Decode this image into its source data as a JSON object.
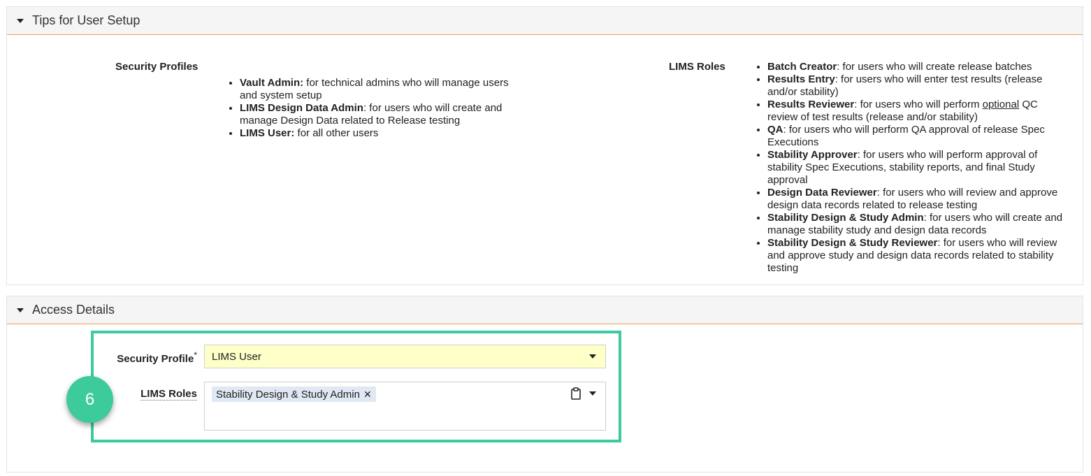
{
  "tips_panel": {
    "title": "Tips for User Setup",
    "security_profiles": {
      "label": "Security Profiles",
      "items": [
        {
          "name": "Vault Admin:",
          "desc": " for technical admins who will manage users and system setup"
        },
        {
          "name": "LIMS Design Data Admin",
          "desc": ": for users who will create and manage Design Data related to Release testing"
        },
        {
          "name": "LIMS User:",
          "desc": " for all other users"
        }
      ]
    },
    "lims_roles": {
      "label": "LIMS Roles",
      "items": [
        {
          "name": "Batch Creator",
          "desc": ": for users who will create release batches"
        },
        {
          "name": "Results Entry",
          "desc": ": for users who will enter test results (release and/or stability)"
        },
        {
          "name": "Results Reviewer",
          "desc_before": ": for users who will perform ",
          "desc_underline": "optional",
          "desc_after": " QC review of test results (release and/or stability)"
        },
        {
          "name": "QA",
          "desc": ": for users who will perform QA approval of release Spec Executions"
        },
        {
          "name": "Stability Approver",
          "desc": ": for users who will perform approval of stability Spec Executions, stability reports, and final Study approval"
        },
        {
          "name": "Design Data Reviewer",
          "desc": ": for users who will review and approve design data records related to release testing"
        },
        {
          "name": "Stability Design & Study Admin",
          "desc": ": for users who will create and manage stability study and design data records"
        },
        {
          "name": "Stability Design & Study Reviewer",
          "desc": ": for users who will review and approve study and design data records related to stability testing"
        }
      ]
    }
  },
  "access_panel": {
    "title": "Access Details",
    "security_profile": {
      "label": "Security Profile",
      "required_marker": "*",
      "value": "LIMS User"
    },
    "lims_roles": {
      "label": "LIMS Roles",
      "chips": [
        {
          "label": "Stability Design & Study Admin",
          "remove": "✕"
        }
      ]
    },
    "step_badge": "6"
  },
  "colors": {
    "accent_orange": "#f0a04b",
    "highlight_green": "#3ecb9b",
    "required_field_bg": "#ffffc8",
    "chip_bg": "#dfe8f3"
  }
}
